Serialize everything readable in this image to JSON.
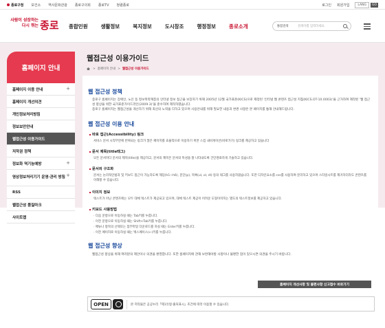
{
  "topbar": {
    "home": "종로구청",
    "links": [
      "보건소",
      "역사문화관광",
      "종로구의회",
      "종로TV",
      "청렴종로"
    ],
    "login": "로그인",
    "join": "회원가입",
    "lang": "LANG",
    "go": "GO"
  },
  "logo": {
    "slogan_1": "사람이 성장하는",
    "slogan_2": "다시 뛰는",
    "name": "종로"
  },
  "gnb": [
    "종합민원",
    "생활정보",
    "복지정보",
    "도시창조",
    "행정정보",
    "종로소개"
  ],
  "search": {
    "tag": "통합검색",
    "placeholder": "검색어를 입력하세요."
  },
  "sidebar": {
    "title": "홈페이지 안내",
    "items": [
      {
        "label": "홈페이지 이용 안내",
        "plus": "+"
      },
      {
        "label": "홈페이지 개선의견",
        "plus": ""
      },
      {
        "label": "개인정보처리방침",
        "plus": ""
      },
      {
        "label": "정보보안안내",
        "plus": ""
      },
      {
        "label": "웹접근성 이용가이드",
        "plus": ""
      },
      {
        "label": "저작권 정책",
        "plus": ""
      },
      {
        "label": "정보화 역기능예방",
        "plus": "+"
      },
      {
        "label": "영상정보처리기기 운영·관리 방침",
        "plus": "+"
      },
      {
        "label": "RSS",
        "plus": ""
      },
      {
        "label": "웹접근성 품질마크",
        "plus": ""
      },
      {
        "label": "사이트맵",
        "plus": ""
      }
    ]
  },
  "page": {
    "title": "웹접근성 이용가이드",
    "breadcrumb": [
      "홈페이지 안내",
      "웹접근성 이용가이드"
    ]
  },
  "content": {
    "policy_title": "웹 접근성 정책",
    "policy_p1": "종로구 홈페이지는 장애인, 노인 등 정보취약계층의 인터넷 정보 접근을 보장하기 위해 2005년 12월 국가표준(KICS)으로 제정된 '인터넷 웹 콘텐츠 접근성 지침(KICS.OT-10.0003)'을 근거하여 제작된 '웹 접근성 향상을 위한 국가표준가이드라인(2009.3)'을 준수하여 제작하였습니다.",
    "policy_p2": "종로구 홈페이지는 웹접근성을 개선하기 위해 최선의 노력을 다하고 있으며 사용안내를 위해 필요한 내용과 변경 사항은 본 페이지를 통해 안내해드립니다.",
    "guide_title": "웹 접근성 이용 안내",
    "s1_title": "바로 접근(Accessibility) 링크",
    "s1_text": "서비스 문서 시작부분에 반복되는 링크가 많은 페이지를 효율적으로 이용하기 위한 스킵 내비게이션(바로가기) 링크를 제공하고 있습니다",
    "s2_title": "문서 제목(title태그)",
    "s2_text": "모든 문서마다 문서의 제목(title)을 제공하고, 문서의 제목은 문서의 특성을 잘 나타내도록 간단명료하게 기술하고 있습니다.",
    "s3_title": "문서의 구조화",
    "s3_text": "문서는 논리적인법과 및 키보드 접근이 가능하도록 헤딩(h1~h6), 문단(p), 목록(ul, ol, dl) 등의 태그를 사용하였습니다. 또한 디자인요소를 css를 사용하여 분리하고 있으며 스타일시트를 제거하더라도 콘텐츠를 이해할 수 있습니다.",
    "s4_title": "이미지 정보",
    "s4_text": "텍스트가 아닌 콘텐츠에는 모두 대체 텍스트가 제공되고 있으며, 대체 텍스트 제공이 어려운 도형이미지는 별도의 텍스트정보를 제공하고 있습니다.",
    "s5_title": "키보드 사용방법",
    "s5_items": [
      "· 다음 문항으로 이동하실 때는 Tab키를 누릅니다.",
      "· 이전 문항으로 이동하실 때는 Shift+Tab키를 누릅니다.",
      "· 메뉴나 항목의 선택또는 첨부파일 다운로드를 하실 때는 Enter키를 누릅니다.",
      "· 이전 페이지로 이동하실 때는 백스페이스(←)키를 누릅니다."
    ],
    "improve_title": "웹 접근성 향상",
    "improve_text": "웹접근성 향상을 위해 여러분의 제안이나 의견을 환영합니다. 또한 홈페이지에 관해 보완해야할 사항이나 불편한 점이 있으시면 의견을 주시기 바랍니다.",
    "report_button": "홈페이지 개선사항 및 불편사항 신고접수 바로가기"
  },
  "kogl": {
    "open_label": "OPEN",
    "text": "본 저작물은 공공누리「제1유형:출처표시」조건에 따라 이용할 수 있습니다."
  }
}
